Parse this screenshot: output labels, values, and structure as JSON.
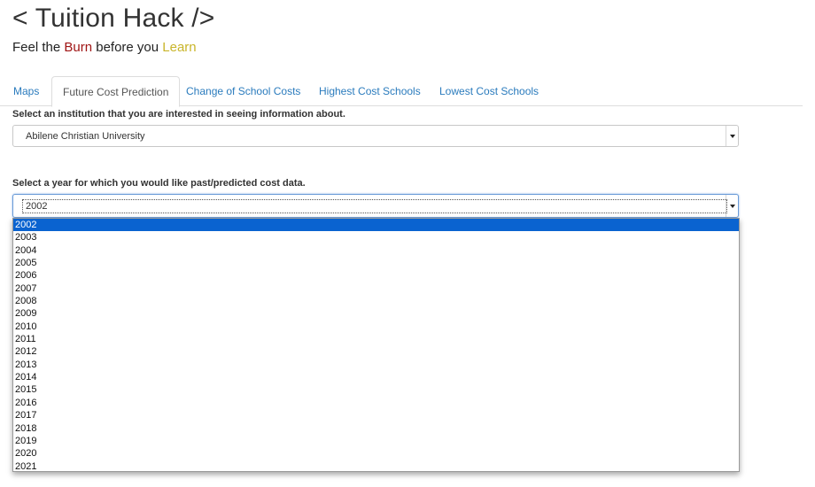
{
  "header": {
    "title": "< Tuition Hack />",
    "tagline": {
      "part1": "Feel the ",
      "burn": "Burn",
      "part2": " before you ",
      "learn": "Learn"
    }
  },
  "tabs": [
    {
      "label": "Maps",
      "active": false
    },
    {
      "label": "Future Cost Prediction",
      "active": true
    },
    {
      "label": "Change of School Costs",
      "active": false
    },
    {
      "label": "Highest Cost Schools",
      "active": false
    },
    {
      "label": "Lowest Cost Schools",
      "active": false
    }
  ],
  "institution": {
    "label": "Select an institution that you are interested in seeing information about.",
    "selected": "Abilene Christian University"
  },
  "year": {
    "label": "Select a year for which you would like past/predicted cost data.",
    "selected": "2002",
    "options": [
      "2002",
      "2003",
      "2004",
      "2005",
      "2006",
      "2007",
      "2008",
      "2009",
      "2010",
      "2011",
      "2012",
      "2013",
      "2014",
      "2015",
      "2016",
      "2017",
      "2018",
      "2019",
      "2020",
      "2021"
    ]
  },
  "colors": {
    "burn": "#a01515",
    "learn": "#c9b52a",
    "link": "#2a7bbd",
    "highlight": "#0a63d0"
  }
}
